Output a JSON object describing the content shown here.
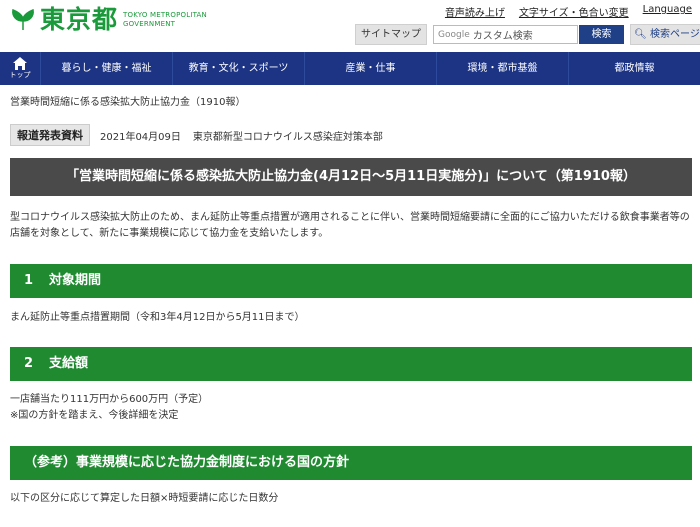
{
  "header": {
    "logo_name": "東京都",
    "logo_en_line1": "TOKYO METROPOLITAN",
    "logo_en_line2": "GOVERNMENT",
    "util_links": [
      "音声読み上げ",
      "文字サイズ・色合い変更",
      "Language"
    ],
    "sitemap_label": "サイトマップ",
    "search_google": "Google",
    "search_placeholder": "カスタム検索",
    "search_button": "検索",
    "advanced_search": "検索ページ"
  },
  "nav": {
    "home_label": "トップ",
    "items": [
      "暮らし・健康・福祉",
      "教育・文化・スポーツ",
      "産業・仕事",
      "環境・都市基盤",
      "都政情報"
    ]
  },
  "breadcrumb": "営業時間短縮に係る感染拡大防止協力金（1910報）",
  "press": {
    "label": "報道発表資料",
    "date": "2021年04月09日",
    "department": "東京都新型コロナウイルス感染症対策本部"
  },
  "title": "「営業時間短縮に係る感染拡大防止協力金(4月12日～5月11日実施分)」について（第1910報）",
  "intro": "型コロナウイルス感染拡大防止のため、まん延防止等重点措置が適用されることに伴い、営業時間短縮要請に全面的にご協力いただける飲食事業者等の店舗を対象として、新たに事業規模に応じて協力金を支給いたします。",
  "sections": [
    {
      "num": "1",
      "title": "対象期間",
      "lines": [
        "まん延防止等重点措置期間（令和3年4月12日から5月11日まで）"
      ]
    },
    {
      "num": "2",
      "title": "支給額",
      "lines": [
        "一店舗当たり111万円から600万円（予定）",
        "※国の方針を踏まえ、今後詳細を決定"
      ]
    }
  ],
  "reference": {
    "title": "（参考）事業規模に応じた協力金制度における国の方針",
    "line": "以下の区分に応じて算定した日額×時短要請に応じた日数分"
  },
  "colors": {
    "nav_bg": "#1d3484",
    "section_green": "#1f8a30",
    "title_gray": "#4a4a4a",
    "logo_green": "#1a9a3a"
  }
}
